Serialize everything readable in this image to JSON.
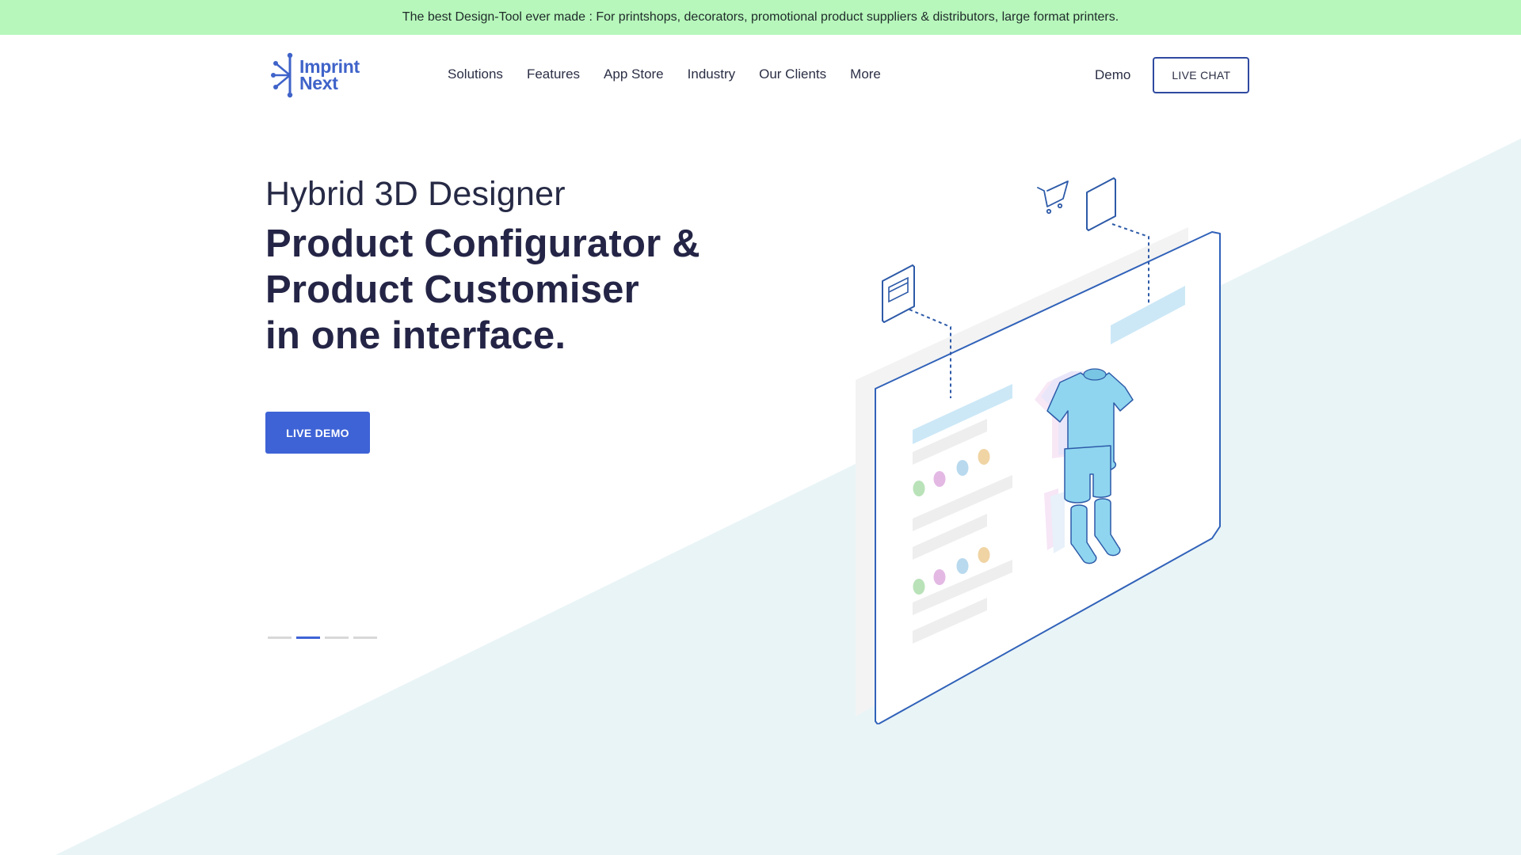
{
  "colors": {
    "announcement_bg": "#b7f7bb",
    "brand_blue": "#3e63d6",
    "heading": "#242546",
    "diagonal_bg": "#e9f4f6"
  },
  "announcement": {
    "text": "The best Design-Tool ever made : For printshops, decorators, promotional product suppliers & distributors, large format printers."
  },
  "logo": {
    "line1": "Imprint",
    "line2": "Next"
  },
  "nav": {
    "items": [
      {
        "label": "Solutions"
      },
      {
        "label": "Features"
      },
      {
        "label": "App Store"
      },
      {
        "label": "Industry"
      },
      {
        "label": "Our Clients"
      },
      {
        "label": "More"
      }
    ],
    "demo_label": "Demo",
    "live_chat_label": "LIVE CHAT"
  },
  "hero": {
    "subtitle": "Hybrid 3D Designer",
    "title_lines": [
      "Product Configurator &",
      "Product Customiser",
      "in one interface."
    ],
    "cta_label": "LIVE DEMO"
  },
  "slider": {
    "total": 4,
    "active_index": 1
  },
  "illustration": {
    "icons": [
      "cart-icon",
      "credit-card-icon",
      "tag-card-icon"
    ],
    "garments": [
      "t-shirt",
      "shorts",
      "socks"
    ]
  }
}
